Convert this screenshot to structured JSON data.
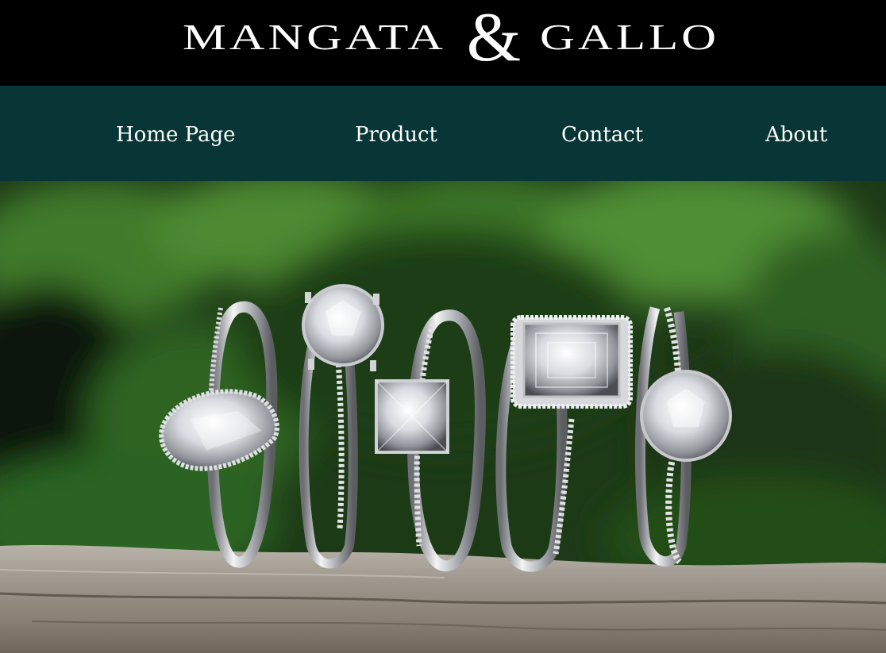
{
  "brand": {
    "name_left": "MANGATA",
    "ampersand": "&",
    "name_right": "GALLO"
  },
  "nav": {
    "items": [
      {
        "label": "Home Page"
      },
      {
        "label": "Product"
      },
      {
        "label": "Contact"
      },
      {
        "label": "About"
      }
    ]
  },
  "colors": {
    "header_bg": "#000000",
    "nav_bg": "#083535",
    "nav_text": "#ffffff"
  }
}
